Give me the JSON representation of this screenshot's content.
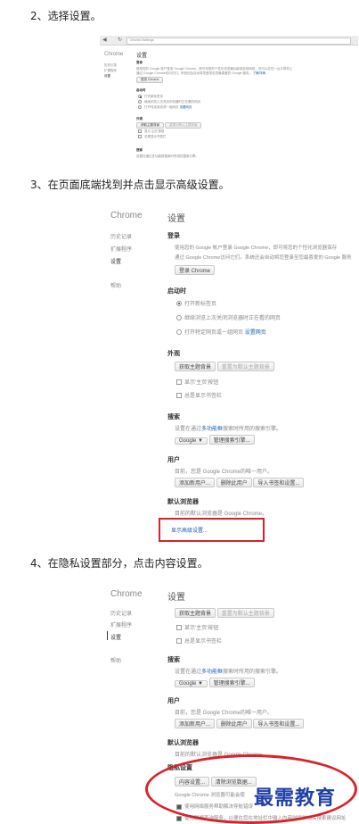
{
  "steps": {
    "s2": "2、选择设置。",
    "s3": "3、在页面底端找到并点击显示高级设置。",
    "s4": "4、在隐私设置部分，点击内容设置。"
  },
  "shot1": {
    "url": "chrome://settings",
    "sidebar_title": "Chrome",
    "nav": [
      "历史记录",
      "扩展程序",
      "设置"
    ],
    "page_title": "设置",
    "login_head": "登录",
    "login_text1": "使用您的 Google 帐户登录 Google Chrome，即可将您的个性化浏览器功能保存到网络，还可以在任一台计算机上",
    "login_text2": "通过 Google Chrome访问它们。系统还会自动将您登录至您最喜爱的 Google 服务。",
    "login_more": "了解详情",
    "login_btn": "登录 Chrome",
    "startup_head": "启动时",
    "startup_opts": [
      "打开新标签页",
      "继续浏览上次关闭浏览器时正在看的网页",
      "打开特定网页或一组网页"
    ],
    "startup_link": "设置网页",
    "appearance_head": "外观",
    "theme_btn": "获取主题背景",
    "reset_btn": "重置为默认主题背景",
    "home_cb": "显示'主页'按钮",
    "bookmark_cb": "总是显示书签栏",
    "search_head": "搜索",
    "search_text": "设置在通过多功能框搜索时所用的搜索引擎。"
  },
  "shot2": {
    "sidebar_title": "Chrome",
    "nav": [
      "历史记录",
      "扩展程序",
      "设置",
      "帮助"
    ],
    "page_title": "设置",
    "login_head": "登录",
    "login_text1": "使用您的 Google 帐户登录 Google Chrome，即可将您的个性化浏览器保存",
    "login_text2": "通过 Google Chrome访问它们。系统还会自动将您登录至您最喜爱的 Google 服务",
    "login_btn": "登录 Chrome",
    "startup_head": "启动时",
    "startup_opts": [
      "打开新标签页",
      "继续浏览上次关闭浏览器时正在看的网页",
      "打开特定网页或一组网页"
    ],
    "startup_link": "设置网页",
    "appearance_head": "外观",
    "theme_btn": "获取主题背景",
    "reset_btn": "重置为默认主题背景",
    "home_cb": "显示'主页'按钮",
    "bookmark_cb": "总是显示书签栏",
    "search_head": "搜索",
    "search_text_pre": "设置在通过",
    "search_text_link": "多功能框",
    "search_text_post": "搜索时所用的搜索引擎。",
    "engine": "Google ▼",
    "manage_btn": "管理搜索引擎...",
    "users_head": "用户",
    "users_text": "目前，您是 Google Chrome的唯一用户。",
    "add_user_btn": "添加新用户...",
    "del_user_btn": "删除此用户",
    "import_btn": "导入书签和设置...",
    "default_head": "默认浏览器",
    "default_text": "目前的默认浏览器是 Google Chrome。",
    "advanced_link": "显示高级设置..."
  },
  "shot3": {
    "sidebar_title": "Chrome",
    "nav": [
      "历史记录",
      "扩展程序",
      "设置",
      "帮助"
    ],
    "page_title": "设置",
    "theme_btn": "获取主题背景",
    "reset_btn": "重置为默认主题背景",
    "home_cb": "显示'主页'按钮",
    "bookmark_cb": "总是显示书签栏",
    "search_head": "搜索",
    "search_text_pre": "设置在通过",
    "search_text_link": "多功能框",
    "search_text_post": "搜索时所用的搜索引擎。",
    "engine": "Google ▼",
    "manage_btn": "管理搜索引擎...",
    "users_head": "用户",
    "users_text": "目前，您是 Google Chrome的唯一用户。",
    "add_user_btn": "添加新用户...",
    "del_user_btn": "删除此用户",
    "import_btn": "导入书签和设置...",
    "default_head": "默认浏览器",
    "default_text": "目前的默认浏览器是 Google Chrome。",
    "privacy_head": "隐私设置",
    "content_btn": "内容设置...",
    "clear_btn": "清除浏览数据...",
    "privacy_text": "Google Chrome 浏览器可能会使",
    "privacy_opt1": "使用网络服务帮助解决导航错误",
    "privacy_opt2": "使用联想查询服务，以便在您在地址栏中输入内容时提供相关搜索建议网址"
  },
  "watermark": "最需教育",
  "colors": {
    "annotation_red": "#d8232a",
    "link": "#1a5fb4",
    "watermark_blue": "#1f3fa8"
  }
}
